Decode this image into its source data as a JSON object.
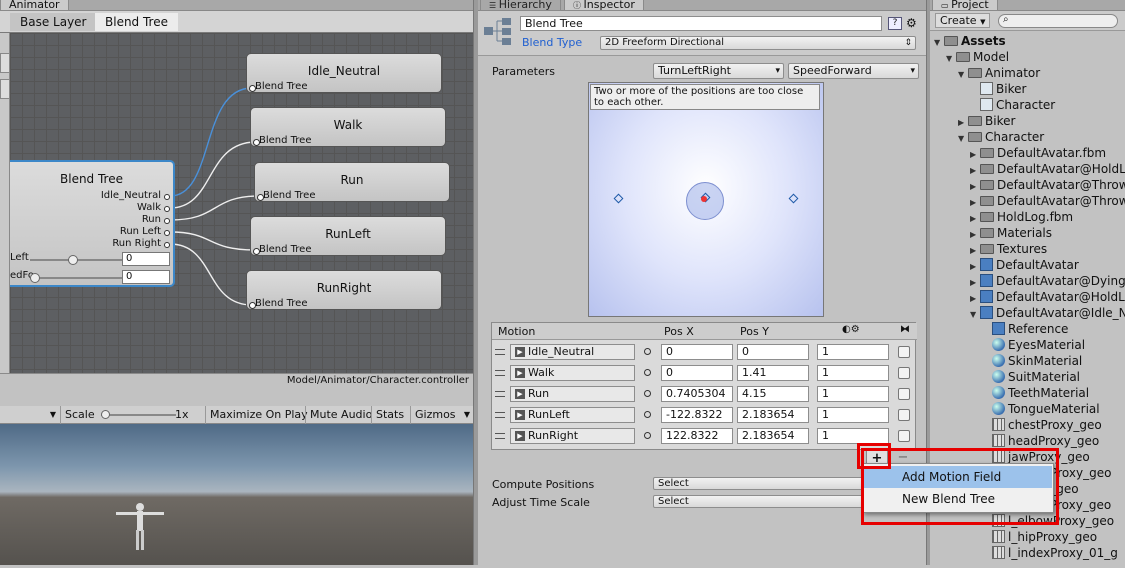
{
  "animator": {
    "tab": "Animator",
    "crumbs": [
      "Base Layer",
      "Blend Tree"
    ],
    "blend_tree_node": {
      "title": "Blend Tree",
      "outputs": [
        "Idle_Neutral",
        "Walk",
        "Run",
        "Run Left",
        "Run Right"
      ],
      "params": [
        {
          "label": "Left",
          "value": "0"
        },
        {
          "label": "edFo",
          "value": "0"
        }
      ]
    },
    "child_nodes": [
      {
        "title": "Idle_Neutral",
        "input": "Blend Tree"
      },
      {
        "title": "Walk",
        "input": "Blend Tree"
      },
      {
        "title": "Run",
        "input": "Blend Tree"
      },
      {
        "title": "RunLeft",
        "input": "Blend Tree"
      },
      {
        "title": "RunRight",
        "input": "Blend Tree"
      }
    ],
    "path": "Model/Animator/Character.controller"
  },
  "game": {
    "scale_label": "Scale",
    "scale_value": "1x",
    "buttons": [
      "Maximize On Play",
      "Mute Audio",
      "Stats",
      "Gizmos"
    ]
  },
  "inspector": {
    "tabs": [
      "Hierarchy",
      "Inspector"
    ],
    "name": "Blend Tree",
    "blend_type_label": "Blend Type",
    "blend_type_value": "2D Freeform Directional",
    "parameters_label": "Parameters",
    "param_x": "TurnLeftRight",
    "param_y": "SpeedForward",
    "warning": "Two or more of the positions are too close to each other.",
    "motion_headers": {
      "motion": "Motion",
      "posx": "Pos X",
      "posy": "Pos Y"
    },
    "motions": [
      {
        "name": "Idle_Neutral",
        "posx": "0",
        "posy": "0",
        "speed": "1"
      },
      {
        "name": "Walk",
        "posx": "0",
        "posy": "1.41",
        "speed": "1"
      },
      {
        "name": "Run",
        "posx": "0.7405304",
        "posy": "4.15",
        "speed": "1"
      },
      {
        "name": "RunLeft",
        "posx": "-122.8322",
        "posy": "2.183654",
        "speed": "1"
      },
      {
        "name": "RunRight",
        "posx": "122.8322",
        "posy": "2.183654",
        "speed": "1"
      }
    ],
    "plus_label": "+",
    "minus_label": "−",
    "compute_positions_label": "Compute Positions",
    "compute_positions_value": "Select",
    "adjust_time_scale_label": "Adjust Time Scale",
    "adjust_time_scale_value": "Select"
  },
  "popup": {
    "items": [
      "Add Motion Field",
      "New Blend Tree"
    ]
  },
  "project": {
    "tab": "Project",
    "create_label": "Create",
    "tree": [
      {
        "label": "Assets",
        "kind": "folder",
        "bold": true
      },
      {
        "label": "Model",
        "kind": "folder"
      },
      {
        "label": "Animator",
        "kind": "folder"
      },
      {
        "label": "Biker",
        "kind": "controller"
      },
      {
        "label": "Character",
        "kind": "controller"
      },
      {
        "label": "Biker",
        "kind": "folder"
      },
      {
        "label": "Character",
        "kind": "folder"
      },
      {
        "label": "DefaultAvatar.fbm",
        "kind": "folder"
      },
      {
        "label": "DefaultAvatar@HoldL",
        "kind": "folder"
      },
      {
        "label": "DefaultAvatar@Throw",
        "kind": "folder"
      },
      {
        "label": "DefaultAvatar@Throw",
        "kind": "folder"
      },
      {
        "label": "HoldLog.fbm",
        "kind": "folder"
      },
      {
        "label": "Materials",
        "kind": "folder"
      },
      {
        "label": "Textures",
        "kind": "folder"
      },
      {
        "label": "DefaultAvatar",
        "kind": "cube"
      },
      {
        "label": "DefaultAvatar@Dying",
        "kind": "cube"
      },
      {
        "label": "DefaultAvatar@HoldL",
        "kind": "cube"
      },
      {
        "label": "DefaultAvatar@Idle_N",
        "kind": "cube"
      },
      {
        "label": "Reference",
        "kind": "cube"
      },
      {
        "label": "EyesMaterial",
        "kind": "sphere"
      },
      {
        "label": "SkinMaterial",
        "kind": "sphere"
      },
      {
        "label": "SuitMaterial",
        "kind": "sphere"
      },
      {
        "label": "TeethMaterial",
        "kind": "sphere"
      },
      {
        "label": "TongueMaterial",
        "kind": "sphere"
      },
      {
        "label": "chestProxy_geo",
        "kind": "mesh"
      },
      {
        "label": "headProxy_geo",
        "kind": "mesh"
      },
      {
        "label": "jawProxy_geo",
        "kind": "mesh"
      },
      {
        "label": "l_ProxyProxy_geo",
        "kind": "mesh"
      },
      {
        "label": "l_Proxy_geo",
        "kind": "mesh"
      },
      {
        "label": "l_ankleProxy_geo",
        "kind": "mesh"
      },
      {
        "label": "l_elbowProxy_geo",
        "kind": "mesh"
      },
      {
        "label": "l_hipProxy_geo",
        "kind": "mesh"
      },
      {
        "label": "l_indexProxy_01_g",
        "kind": "mesh"
      }
    ]
  }
}
